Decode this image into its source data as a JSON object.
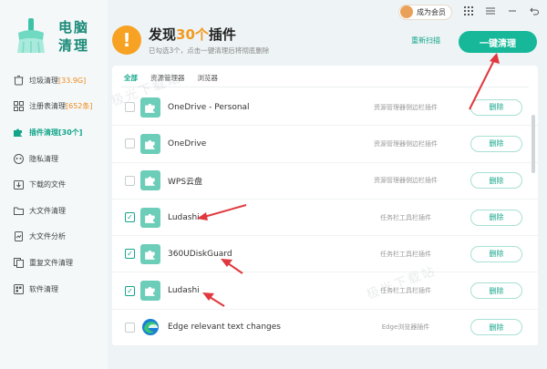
{
  "app": {
    "name_line1": "电脑",
    "name_line2": "清理"
  },
  "titlebar": {
    "vip_label": "成为会员",
    "icons": [
      "grid-icon",
      "menu-icon",
      "minimize-icon",
      "back-icon"
    ]
  },
  "sidebar": {
    "items": [
      {
        "label": "垃圾清理",
        "count": "[33.9G]",
        "icon": "trash-icon"
      },
      {
        "label": "注册表清理",
        "count": "[652条]",
        "icon": "registry-icon"
      },
      {
        "label": "插件清理",
        "count": "[30个]",
        "icon": "puzzle-icon",
        "active": true
      },
      {
        "label": "隐私清理",
        "count": "",
        "icon": "privacy-icon"
      },
      {
        "label": "下载的文件",
        "count": "",
        "icon": "download-icon"
      },
      {
        "label": "大文件清理",
        "count": "",
        "icon": "folder-icon"
      },
      {
        "label": "大文件分析",
        "count": "",
        "icon": "analysis-icon"
      },
      {
        "label": "重复文件清理",
        "count": "",
        "icon": "duplicate-icon"
      },
      {
        "label": "软件清理",
        "count": "",
        "icon": "software-icon"
      }
    ]
  },
  "header": {
    "icon_glyph": "!",
    "title_prefix": "发现",
    "title_count": "30个",
    "title_suffix": "插件",
    "subtitle": "已勾选3个，点击一键清理后将彻底删除",
    "rescan_label": "重新扫描",
    "clean_label": "一键清理"
  },
  "tabs": [
    {
      "label": "全部",
      "active": true
    },
    {
      "label": "资源管理器",
      "active": false
    },
    {
      "label": "浏览器",
      "active": false
    }
  ],
  "plugins": [
    {
      "name": "OneDrive - Personal",
      "type": "资源管理器侧边栏插件",
      "checked": false,
      "icon": "puzzle-icon",
      "delete_label": "删除"
    },
    {
      "name": "OneDrive",
      "type": "资源管理器侧边栏插件",
      "checked": false,
      "icon": "puzzle-icon",
      "delete_label": "删除"
    },
    {
      "name": "WPS云盘",
      "type": "资源管理器侧边栏插件",
      "checked": false,
      "icon": "puzzle-icon",
      "delete_label": "删除"
    },
    {
      "name": "Ludashi",
      "type": "任务栏工具栏插件",
      "checked": true,
      "icon": "puzzle-icon",
      "delete_label": "删除"
    },
    {
      "name": "360UDiskGuard",
      "type": "任务栏工具栏插件",
      "checked": true,
      "icon": "puzzle-icon",
      "delete_label": "删除"
    },
    {
      "name": "Ludashi",
      "type": "任务栏工具栏插件",
      "checked": true,
      "icon": "puzzle-icon",
      "delete_label": "删除"
    },
    {
      "name": "Edge relevant text changes",
      "type": "Edge浏览器插件",
      "checked": false,
      "icon": "edge-icon",
      "delete_label": "删除"
    }
  ],
  "colors": {
    "accent": "#17b89a",
    "warning": "#f7a223",
    "annotation_red": "#e0383e"
  },
  "watermark": "极光下载站"
}
